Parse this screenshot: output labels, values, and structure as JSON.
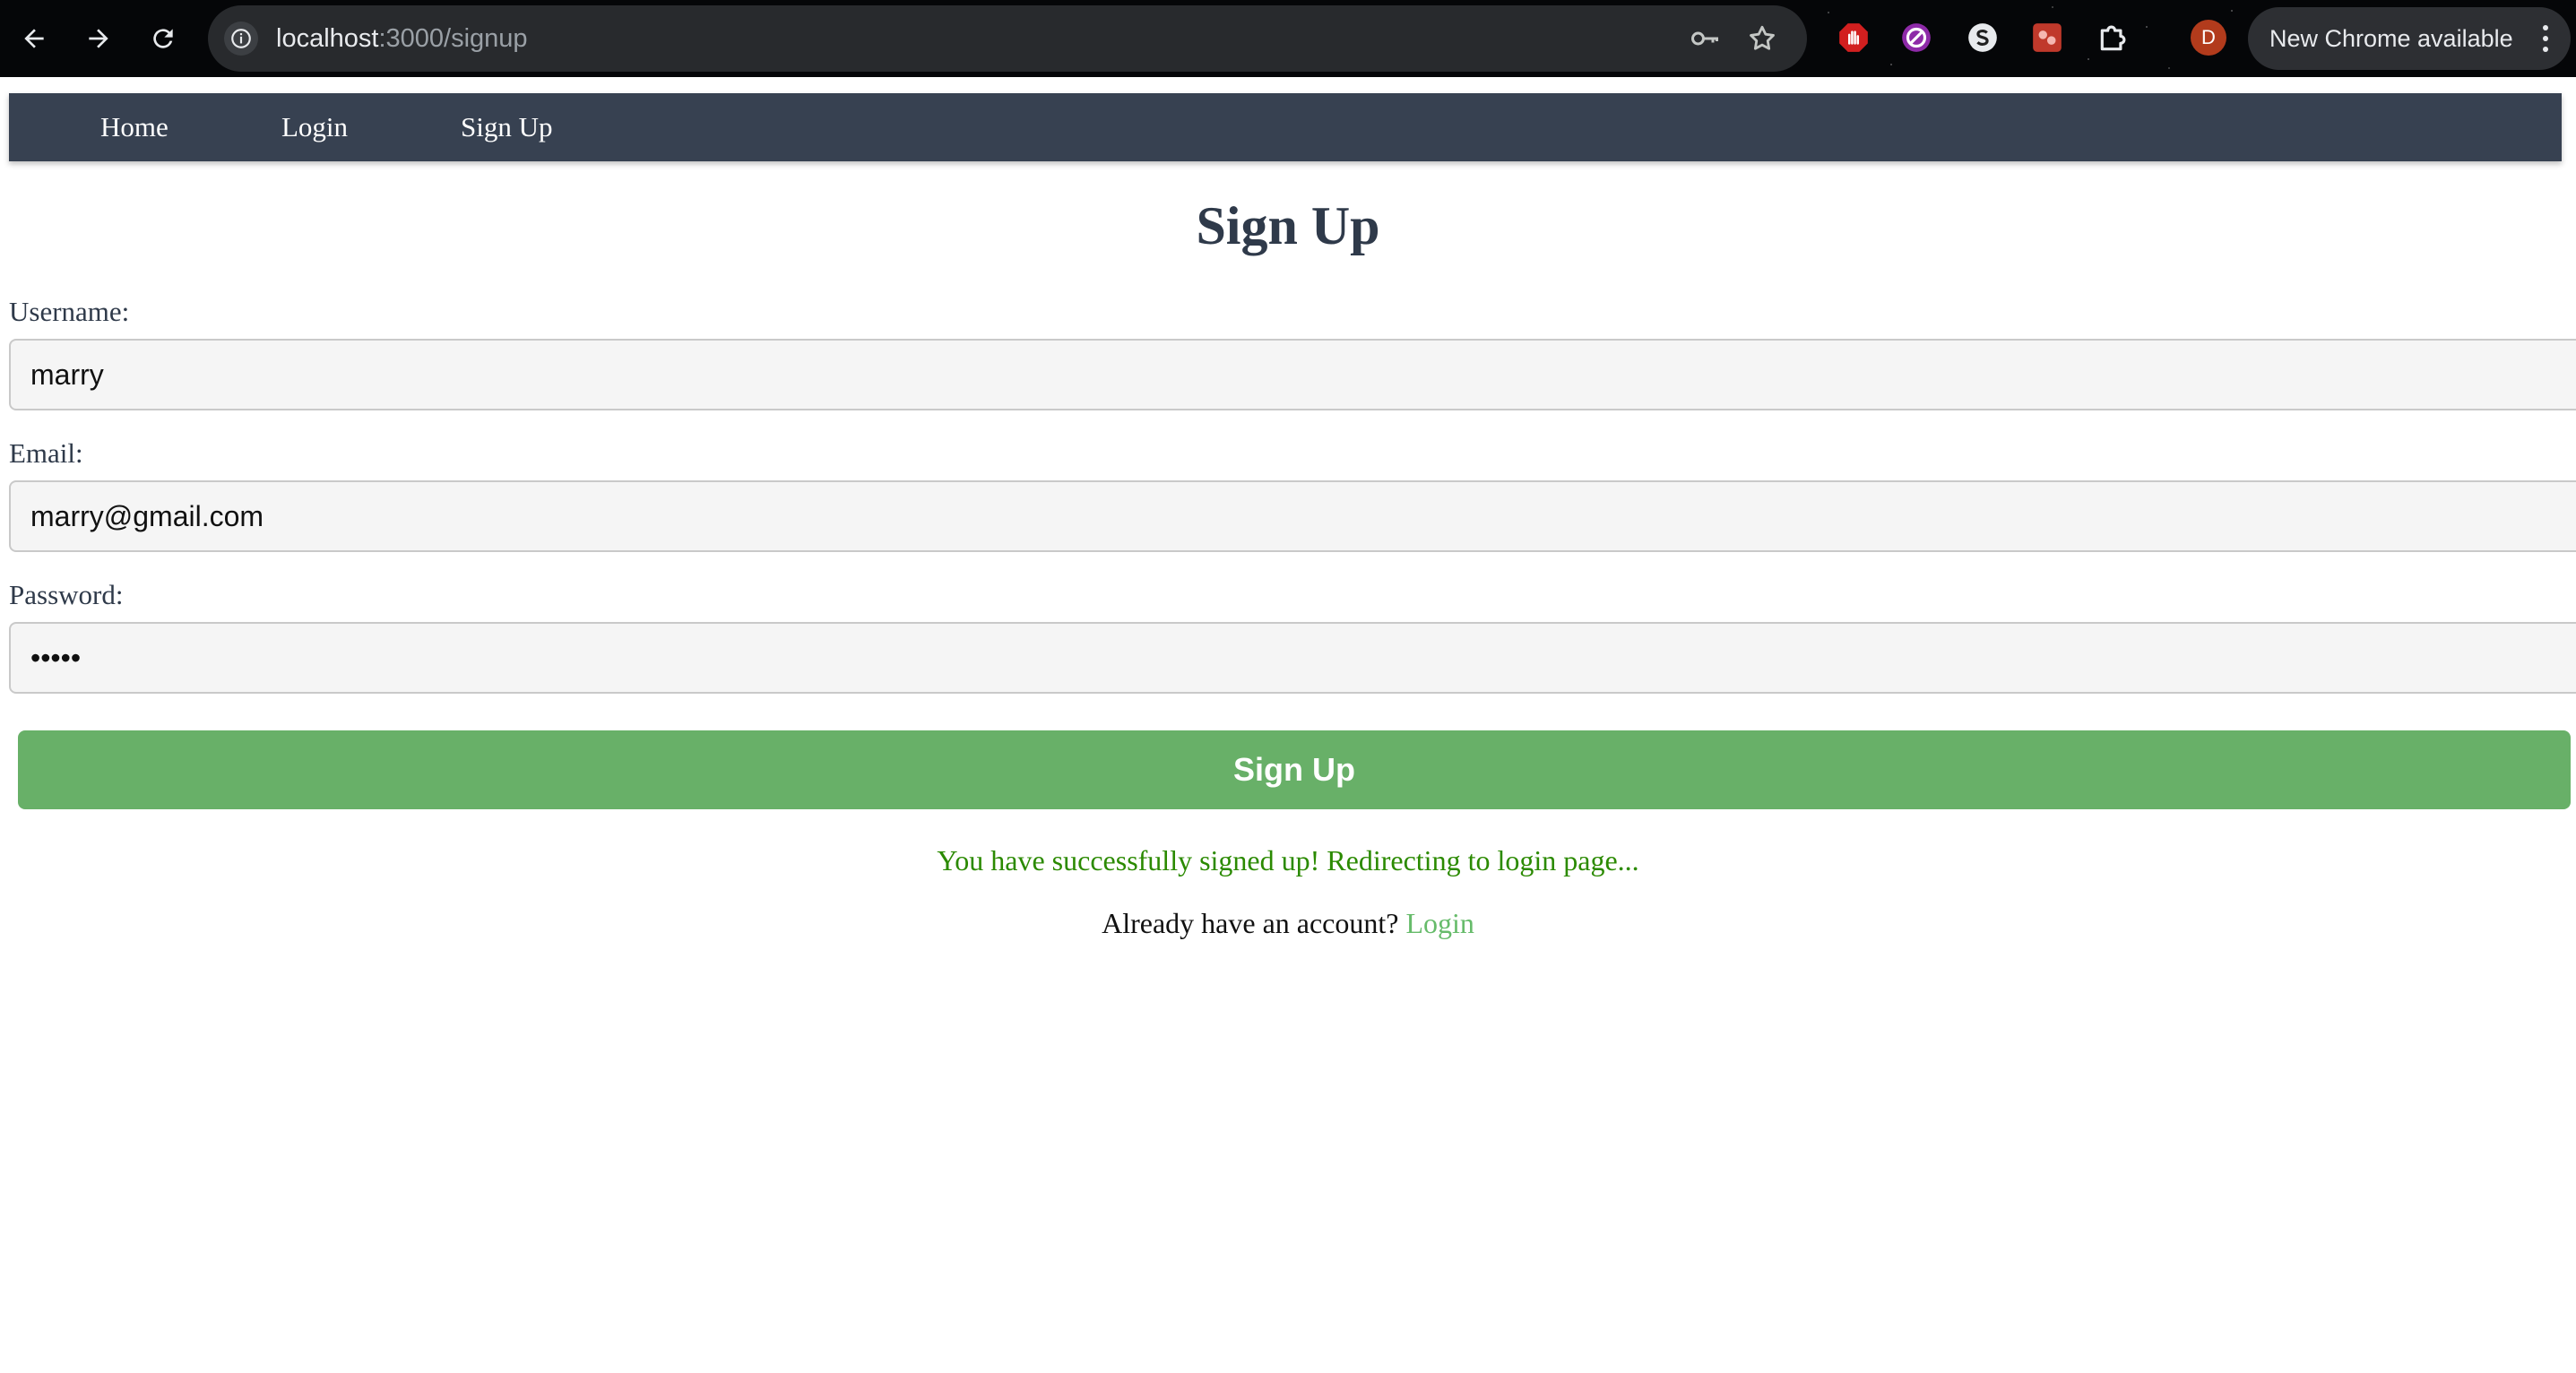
{
  "browser": {
    "url_host": "localhost",
    "url_path": ":3000/signup",
    "profile_initial": "D",
    "update_label": "New Chrome available",
    "icons": [
      "back-arrow-icon",
      "forward-arrow-icon",
      "reload-icon",
      "site-info-icon",
      "password-key-icon",
      "bookmark-star-icon",
      "extension-stop-hand-icon",
      "extension-circle-slash-icon",
      "extension-s-icon",
      "extension-red-app-icon",
      "extensions-puzzle-icon",
      "more-vert-icon"
    ]
  },
  "nav": {
    "items": [
      {
        "label": "Home"
      },
      {
        "label": "Login"
      },
      {
        "label": "Sign Up"
      }
    ],
    "background": "#374151"
  },
  "form": {
    "title": "Sign Up",
    "username": {
      "label": "Username:",
      "value": "marry"
    },
    "email": {
      "label": "Email:",
      "value": "marry@gmail.com"
    },
    "password": {
      "label": "Password:",
      "value": "•••••"
    },
    "submit_label": "Sign Up",
    "submit_color": "#68b068",
    "success_message": "You have successfully signed up! Redirecting to login page...",
    "success_color": "#2b8a00",
    "login_prompt": "Already have an account?",
    "login_link": "Login",
    "login_link_color": "#66bb6a"
  }
}
